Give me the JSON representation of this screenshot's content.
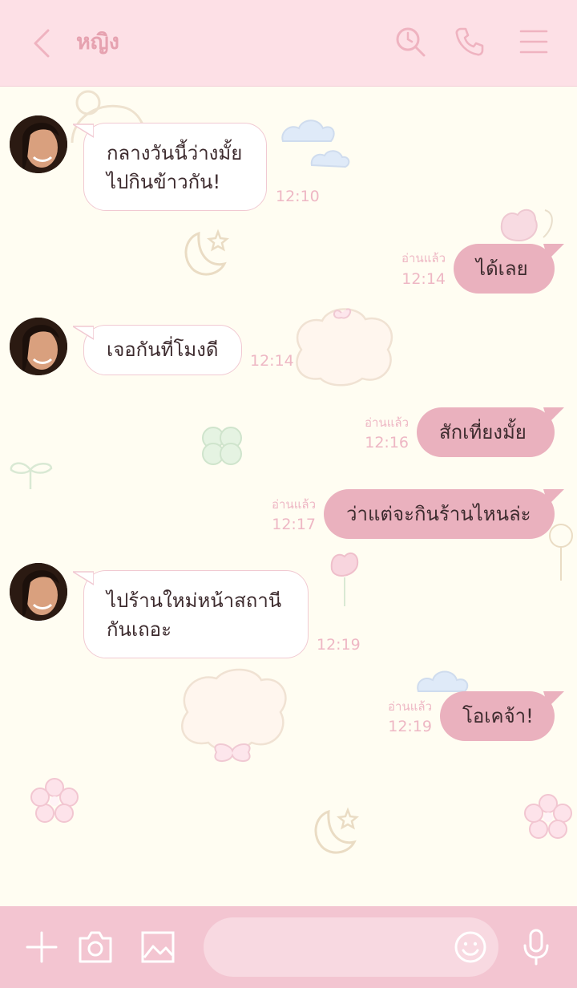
{
  "header": {
    "title": "หญิง",
    "icons": [
      "back-icon",
      "search-icon",
      "phone-icon",
      "menu-icon"
    ]
  },
  "messages": [
    {
      "side": "in",
      "lines": [
        "กลางวันนี้ว่างมั้ย",
        "ไปกินข้าวกัน!"
      ],
      "time": "12:10"
    },
    {
      "side": "out",
      "text": "ได้เลย",
      "read": "อ่านแล้ว",
      "time": "12:14"
    },
    {
      "side": "in",
      "lines": [
        "เจอกันที่โมงดี"
      ],
      "time": "12:14"
    },
    {
      "side": "out",
      "text": "สักเที่ยงมั้ย",
      "read": "อ่านแล้ว",
      "time": "12:16"
    },
    {
      "side": "out",
      "text": "ว่าแต่จะกินร้านไหนล่ะ",
      "read": "อ่านแล้ว",
      "time": "12:17"
    },
    {
      "side": "in",
      "lines": [
        "ไปร้านใหม่หน้าสถานี",
        "กันเถอะ"
      ],
      "time": "12:19"
    },
    {
      "side": "out",
      "text": "โอเคจ้า!",
      "read": "อ่านแล้ว",
      "time": "12:19"
    }
  ],
  "footer": {
    "icons": [
      "plus-icon",
      "camera-icon",
      "image-icon",
      "emoji-icon",
      "microphone-icon"
    ],
    "input_value": ""
  },
  "colors": {
    "header_bg": "#fde0e6",
    "chat_bg": "#fffdf2",
    "outgoing_bubble": "#eab1be",
    "incoming_bubble": "#ffffff",
    "accent_text": "#eeb7c4",
    "footer_bg": "#f3c5d1"
  }
}
